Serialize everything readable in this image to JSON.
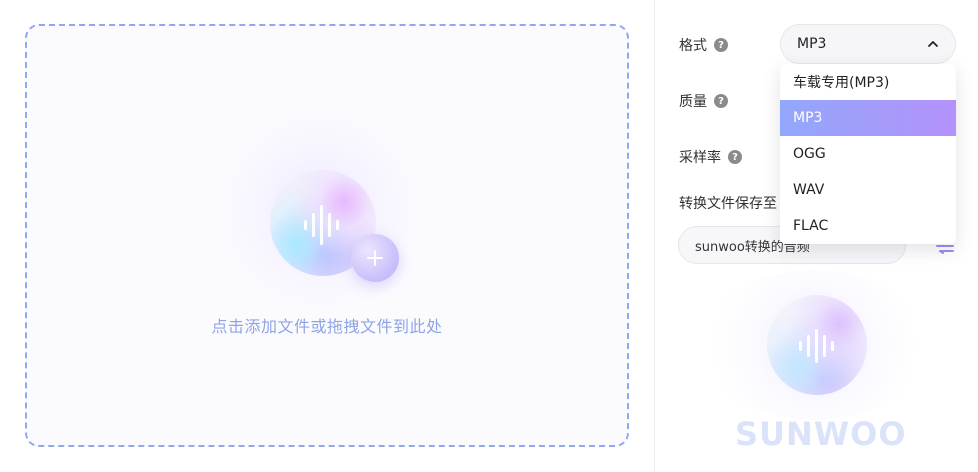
{
  "dropzone": {
    "hint": "点击添加文件或拖拽文件到此处",
    "icon": "audio-wave-icon",
    "add_icon": "plus-icon"
  },
  "settings": {
    "format_label": "格式",
    "quality_label": "质量",
    "samplerate_label": "采样率",
    "save_to_label": "转换文件保存至",
    "help_glyph": "?",
    "format_value": "MP3",
    "save_path": "sunwoo转换的音频",
    "folder_icon": "folder-switch-icon"
  },
  "format_dropdown": {
    "open": true,
    "selected_index": 1,
    "options": [
      "车载专用(MP3)",
      "MP3",
      "OGG",
      "WAV",
      "FLAC"
    ]
  },
  "brand": {
    "name": "SUNWOO",
    "icon": "audio-wave-icon"
  },
  "colors": {
    "accent_start": "#92a7fb",
    "accent_end": "#b392fb",
    "dashed_border": "#8fa8ee",
    "hint_text": "#8fa4e6"
  }
}
